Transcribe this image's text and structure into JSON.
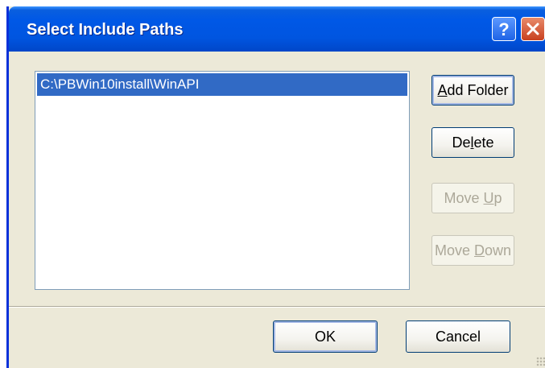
{
  "window": {
    "title": "Select Include Paths",
    "help_label": "?"
  },
  "paths": {
    "items": [
      "C:\\PBWin10install\\WinAPI"
    ],
    "selected_index": 0
  },
  "buttons": {
    "add_folder": {
      "pre": "",
      "key": "A",
      "post": "dd Folder"
    },
    "delete": {
      "pre": "De",
      "key": "l",
      "post": "ete"
    },
    "move_up": {
      "pre": "Move ",
      "key": "U",
      "post": "p"
    },
    "move_down": {
      "pre": "Move ",
      "key": "D",
      "post": "own"
    },
    "ok": "OK",
    "cancel": "Cancel"
  },
  "colors": {
    "selection": "#316ac5",
    "titlebar": "#0055e0",
    "face": "#ece9d8"
  }
}
